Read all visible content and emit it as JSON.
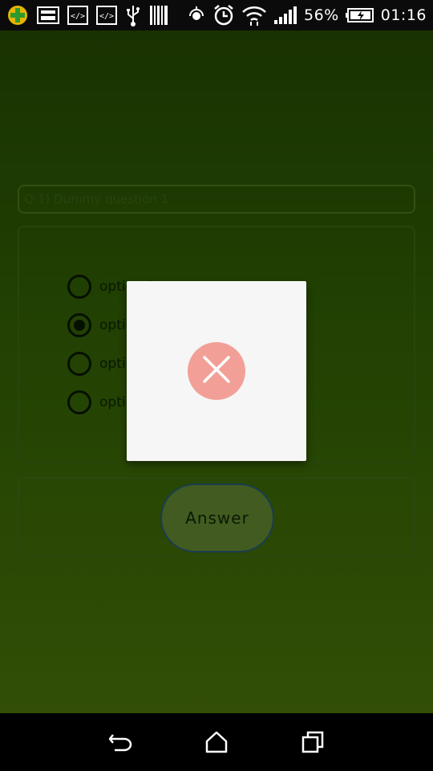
{
  "status_bar": {
    "battery_percent": "56%",
    "time": "01:16",
    "icons": [
      "app-icon",
      "image-icon",
      "code-icon",
      "code-icon",
      "usb-icon",
      "barcode-icon",
      "location-icon",
      "alarm-icon",
      "wifi-icon",
      "signal-icon",
      "battery-icon"
    ]
  },
  "quiz": {
    "question": "Q:1) Dummy question 1",
    "options": [
      {
        "label": "option 1",
        "checked": false
      },
      {
        "label": "option 2",
        "checked": true
      },
      {
        "label": "option 3",
        "checked": false
      },
      {
        "label": "option 4",
        "checked": false
      }
    ],
    "answer_label": "Answer"
  },
  "dialog": {
    "icon": "close-icon",
    "accent_color": "#f2a097"
  },
  "nav": {
    "icons": [
      "back-icon",
      "home-icon",
      "recents-icon"
    ]
  }
}
